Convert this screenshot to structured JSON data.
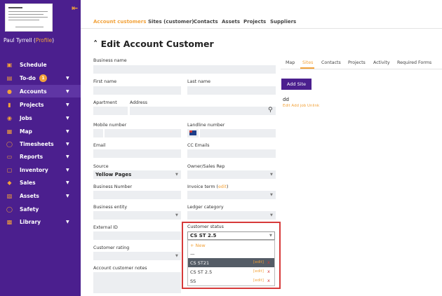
{
  "sidebar": {
    "user_name": "Paul Tyrrell",
    "profile_label": "Profile",
    "items": [
      {
        "label": "Schedule",
        "icon": "calendar-icon",
        "caret": false
      },
      {
        "label": "To-do",
        "icon": "todo-icon",
        "caret": true,
        "badge": "1"
      },
      {
        "label": "Accounts",
        "icon": "user-icon",
        "caret": true,
        "active": true
      },
      {
        "label": "Projects",
        "icon": "folder-icon",
        "caret": true
      },
      {
        "label": "Jobs",
        "icon": "pin-icon",
        "caret": true
      },
      {
        "label": "Map",
        "icon": "map-icon",
        "caret": true
      },
      {
        "label": "Timesheets",
        "icon": "clock-icon",
        "caret": true
      },
      {
        "label": "Reports",
        "icon": "reports-icon",
        "caret": true
      },
      {
        "label": "Inventory",
        "icon": "box-icon",
        "caret": true
      },
      {
        "label": "Sales",
        "icon": "tag-icon",
        "caret": true
      },
      {
        "label": "Assets",
        "icon": "assets-icon",
        "caret": true
      },
      {
        "label": "Safety",
        "icon": "shield-icon",
        "caret": false
      },
      {
        "label": "Library",
        "icon": "book-icon",
        "caret": true
      }
    ]
  },
  "top_tabs": [
    "Account customers",
    "Sites (customer)",
    "Contacts",
    "Assets",
    "Projects",
    "Suppliers"
  ],
  "page_title": "Edit Account Customer",
  "form": {
    "business_name": "Business name",
    "first_name": "First name",
    "last_name": "Last name",
    "apartment": "Apartment",
    "address": "Address",
    "mobile_number": "Mobile number",
    "landline_number": "Landline number",
    "email": "Email",
    "cc_emails": "CC Emails",
    "source": "Source",
    "source_value": "Yellow Pages",
    "owner_sales_rep": "Owner/Sales Rep",
    "business_number": "Business Number",
    "invoice_term": "Invoice term (",
    "invoice_term_edit": "edit",
    "invoice_term_close": ")",
    "business_entity": "Business entity",
    "ledger_category": "Ledger category",
    "external_id": "External ID",
    "customer_status": "Customer status",
    "customer_status_value": "CS ST 2.5",
    "customer_rating": "Customer rating",
    "account_customer_notes": "Account customer notes"
  },
  "dropdown": {
    "new_label": "+ New",
    "blank": "—",
    "options": [
      {
        "label": "CS ST21",
        "edit": "[edit]",
        "x": "x",
        "selected": true
      },
      {
        "label": "CS ST 2.5",
        "edit": "[edit]",
        "x": "x"
      },
      {
        "label": "SS",
        "edit": "[edit]",
        "x": "x"
      }
    ]
  },
  "right_panel": {
    "tabs": [
      "Map",
      "Sites",
      "Contacts",
      "Projects",
      "Activity",
      "Required Forms"
    ],
    "active_tab": "Sites",
    "add_site_label": "Add Site",
    "site_name": "dd",
    "site_actions": "Edit Add job Unlink"
  },
  "colors": {
    "sidebar_bg": "#4b1f8e",
    "accent": "#f2a23a",
    "highlight_border": "#d63a3a"
  }
}
